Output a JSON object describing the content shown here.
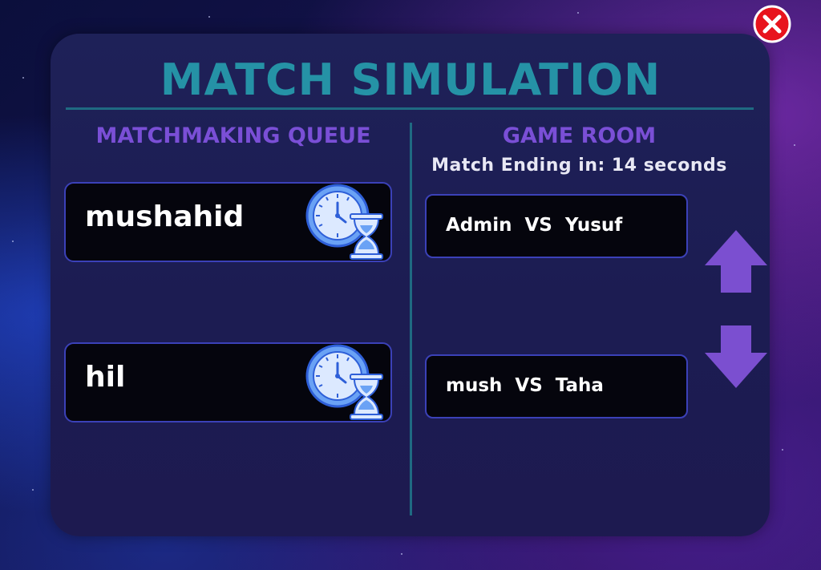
{
  "title": "MATCH SIMULATION",
  "queue": {
    "heading": "MATCHMAKING QUEUE",
    "players": [
      {
        "name": "mushahid",
        "icon": "clock-hourglass-icon"
      },
      {
        "name": "hil",
        "icon": "clock-hourglass-icon"
      }
    ]
  },
  "room": {
    "heading": "GAME ROOM",
    "timer_text": "Match Ending in: 14 seconds",
    "matches": [
      {
        "label": "Admin  VS  Yusuf"
      },
      {
        "label": "mush  VS  Taha"
      }
    ]
  },
  "controls": {
    "scroll_up_icon": "arrow-up-icon",
    "scroll_down_icon": "arrow-down-icon",
    "close_icon": "close-icon"
  },
  "colors": {
    "title": "#2592a6",
    "section_heading": "#7a4fd6",
    "card_border": "#3b41b8",
    "arrow": "#7b4fd0",
    "close": "#e8141d"
  }
}
